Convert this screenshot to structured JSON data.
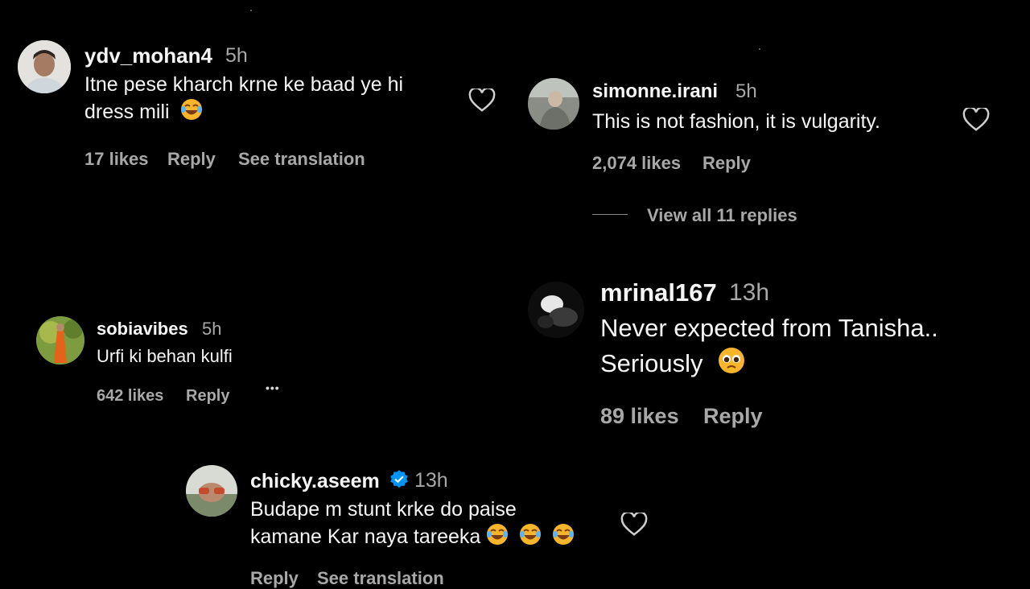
{
  "colors": {
    "background": "#000000",
    "text": "#f5f5f5",
    "muted": "#a8a8a8",
    "verified": "#0095f6",
    "emoji_face": "#f7b52c",
    "emoji_mouth": "#7a3b12"
  },
  "c1": {
    "username": "ydv_mohan4",
    "time": "5h",
    "line1": "Itne pese kharch krne ke baad ye hi",
    "line2": "dress mili",
    "emoji": "face-with-tears-of-joy",
    "likes": "17 likes",
    "reply": "Reply",
    "translate": "See translation"
  },
  "c2": {
    "username": "simonne.irani",
    "time": "5h",
    "line1": "This is not fashion, it is vulgarity.",
    "likes": "2,074 likes",
    "reply": "Reply",
    "view_replies": "View all 11 replies"
  },
  "c3": {
    "username": "sobiavibes",
    "time": "5h",
    "line1": "Urfi ki behan kulfi",
    "likes": "642 likes",
    "reply": "Reply",
    "more": "•••"
  },
  "c4": {
    "username": "mrinal167",
    "time": "13h",
    "line1": "Never expected from Tanisha..",
    "line2": "Seriously",
    "emoji": "pleading-face",
    "likes": "89 likes",
    "reply": "Reply"
  },
  "c5": {
    "username": "chicky.aseem",
    "verified": true,
    "time": "13h",
    "line1": "Budape m stunt krke do paise",
    "line2": "kamane Kar naya tareeka",
    "emoji": "face-with-tears-of-joy",
    "likes": "Reply",
    "translate": "See translation"
  }
}
